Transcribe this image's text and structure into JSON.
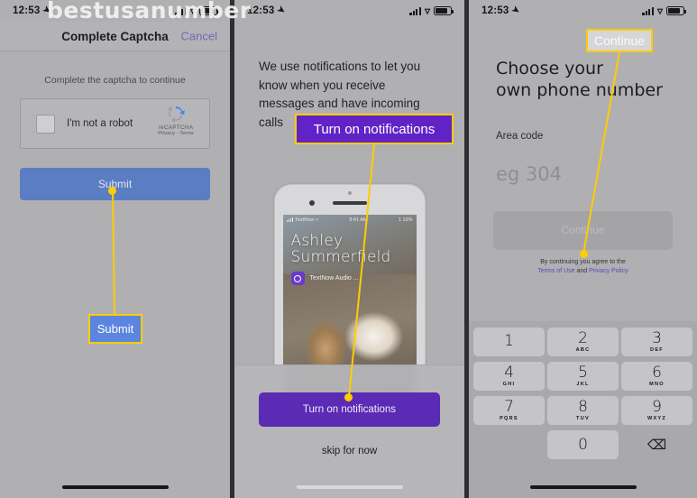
{
  "watermark": "bestusanumber",
  "panel1": {
    "statusbar": {
      "time": "12:53",
      "location_icon": "location-arrow-icon",
      "wifi_icon": "wifi-icon",
      "signal_icon": "cellular-bars-icon",
      "battery_icon": "battery-icon"
    },
    "navbar": {
      "title": "Complete Captcha",
      "cancel_label": "Cancel"
    },
    "hint": "Complete the captcha to continue",
    "recaptcha": {
      "checkbox_label": "I'm not a robot",
      "brand": "reCAPTCHA",
      "terms": "Privacy - Terms",
      "logo_icon": "recaptcha-logo-icon"
    },
    "submit_label": "Submit"
  },
  "panel2": {
    "statusbar": {
      "time": "12:53"
    },
    "copy": "We use notifications to let you know when you receive messages and have incoming calls",
    "phone_mock": {
      "screen_status": {
        "carrier": "TextNow",
        "time": "9:41 AM",
        "battery": "1 13%"
      },
      "caller_name_line1": "Ashley",
      "caller_name_line2": "Summerfield",
      "call_type": "TextNow Audio ...",
      "app_icon": "textnow-app-icon"
    },
    "sheet": {
      "primary_label": "Turn on notifications",
      "skip_label": "skip for now"
    }
  },
  "panel3": {
    "statusbar": {
      "time": "12:53"
    },
    "title_line1": "Choose your",
    "title_line2": "own phone number",
    "area_code_label": "Area code",
    "area_code_placeholder": "eg 304",
    "continue_label": "Continue",
    "terms_prefix": "By continuing you agree to the",
    "terms_link1": "Terms of Use",
    "terms_and": "and",
    "terms_link2": "Privacy Policy",
    "keypad": {
      "rows": [
        [
          {
            "num": "1",
            "sub": ""
          },
          {
            "num": "2",
            "sub": "ABC"
          },
          {
            "num": "3",
            "sub": "DEF"
          }
        ],
        [
          {
            "num": "4",
            "sub": "GHI"
          },
          {
            "num": "5",
            "sub": "JKL"
          },
          {
            "num": "6",
            "sub": "MNO"
          }
        ],
        [
          {
            "num": "7",
            "sub": "PQRS"
          },
          {
            "num": "8",
            "sub": "TUV"
          },
          {
            "num": "9",
            "sub": "WXYZ"
          }
        ]
      ],
      "zero": "0",
      "delete_icon": "backspace-icon"
    }
  },
  "annotations": {
    "accent_color": "#ffcc00",
    "callout_submit": "Submit",
    "callout_notifications": "Turn on notifications",
    "callout_continue": "Continue"
  }
}
